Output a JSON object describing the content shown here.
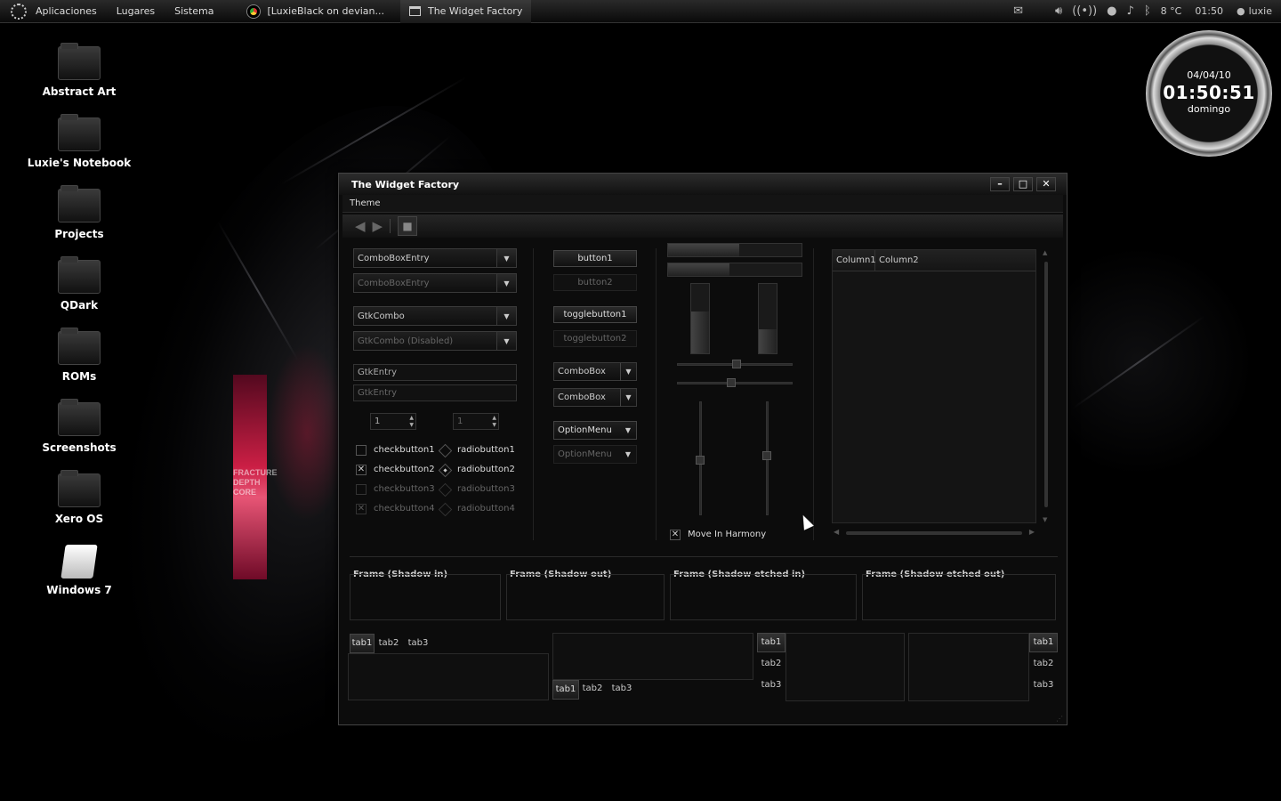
{
  "panel": {
    "menus": [
      "Aplicaciones",
      "Lugares",
      "Sistema"
    ],
    "tasks": [
      {
        "label": "[LuxieBlack on devian...",
        "icon": "chrome-icon"
      },
      {
        "label": "The Widget Factory",
        "icon": "window-icon"
      }
    ],
    "tray": {
      "temperature": "8 °C",
      "time": "01:50",
      "user": "luxie"
    }
  },
  "desktop": {
    "icons": [
      {
        "label": "Abstract Art",
        "type": "folder"
      },
      {
        "label": "Luxie's Notebook",
        "type": "folder"
      },
      {
        "label": "Projects",
        "type": "folder"
      },
      {
        "label": "QDark",
        "type": "folder"
      },
      {
        "label": "ROMs",
        "type": "folder"
      },
      {
        "label": "Screenshots",
        "type": "folder"
      },
      {
        "label": "Xero OS",
        "type": "folder"
      },
      {
        "label": "Windows 7",
        "type": "drive"
      }
    ]
  },
  "clock": {
    "date": "04/04/10",
    "time": "01:50:51",
    "day": "domingo"
  },
  "wallpaper_text": "FRACTURE DEPTH CORE",
  "window": {
    "title": "The Widget Factory",
    "menu": "Theme",
    "col1": {
      "combo_entry": "ComboBoxEntry",
      "combo_entry_disabled": "ComboBoxEntry",
      "gtk_combo": "GtkCombo",
      "gtk_combo_disabled": "GtkCombo (Disabled)",
      "entry": "GtkEntry",
      "entry_disabled": "GtkEntry",
      "spin1": "1",
      "spin2": "1",
      "checks": [
        "checkbutton1",
        "checkbutton2",
        "checkbutton3",
        "checkbutton4"
      ],
      "radios": [
        "radiobutton1",
        "radiobutton2",
        "radiobutton3",
        "radiobutton4"
      ]
    },
    "col2": {
      "button1": "button1",
      "button2": "button2",
      "toggle1": "togglebutton1",
      "toggle2": "togglebutton2",
      "combo1": "ComboBox",
      "combo2": "ComboBox",
      "option1": "OptionMenu",
      "option2": "OptionMenu"
    },
    "col3": {
      "progress_h": [
        0.53,
        0.46
      ],
      "progress_v": [
        0.6,
        0.35
      ],
      "hscale_values": [
        0.52,
        0.47
      ],
      "vscale_values": [
        0.52,
        0.47
      ],
      "move_in_harmony": "Move In Harmony"
    },
    "tree": {
      "columns": [
        "Column1",
        "Column2"
      ]
    },
    "frames": [
      "Frame (Shadow in)",
      "Frame (Shadow out)",
      "Frame (Shadow etched in)",
      "Frame (Shadow etched out)"
    ],
    "tabs": [
      "tab1",
      "tab2",
      "tab3"
    ]
  }
}
